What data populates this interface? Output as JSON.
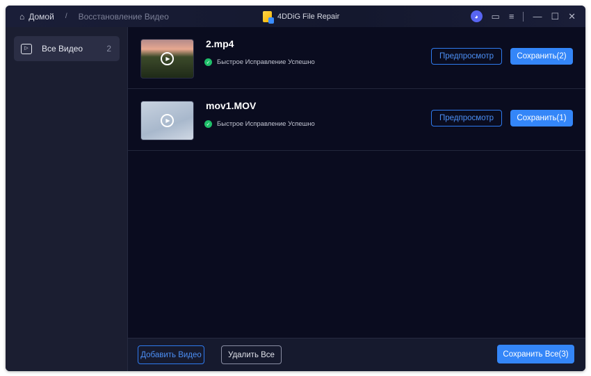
{
  "titlebar": {
    "home": "Домой",
    "separator": "/",
    "current": "Восстановление Видео",
    "app_title": "4DDiG File Repair"
  },
  "sidebar": {
    "items": [
      {
        "label": "Все Видео",
        "count": "2"
      }
    ]
  },
  "files": [
    {
      "name": "2.mp4",
      "status": "Быстрое Исправление Успешно",
      "preview_label": "Предпросмотр",
      "save_label": "Сохранить(2)"
    },
    {
      "name": "mov1.MOV",
      "status": "Быстрое Исправление Успешно",
      "preview_label": "Предпросмотр",
      "save_label": "Сохранить(1)"
    }
  ],
  "footer": {
    "add_label": "Добавить Видео",
    "delete_label": "Удалить Все",
    "save_all_label": "Сохранить Все(3)"
  },
  "colors": {
    "accent": "#3486f8",
    "success": "#1fbf6a"
  }
}
